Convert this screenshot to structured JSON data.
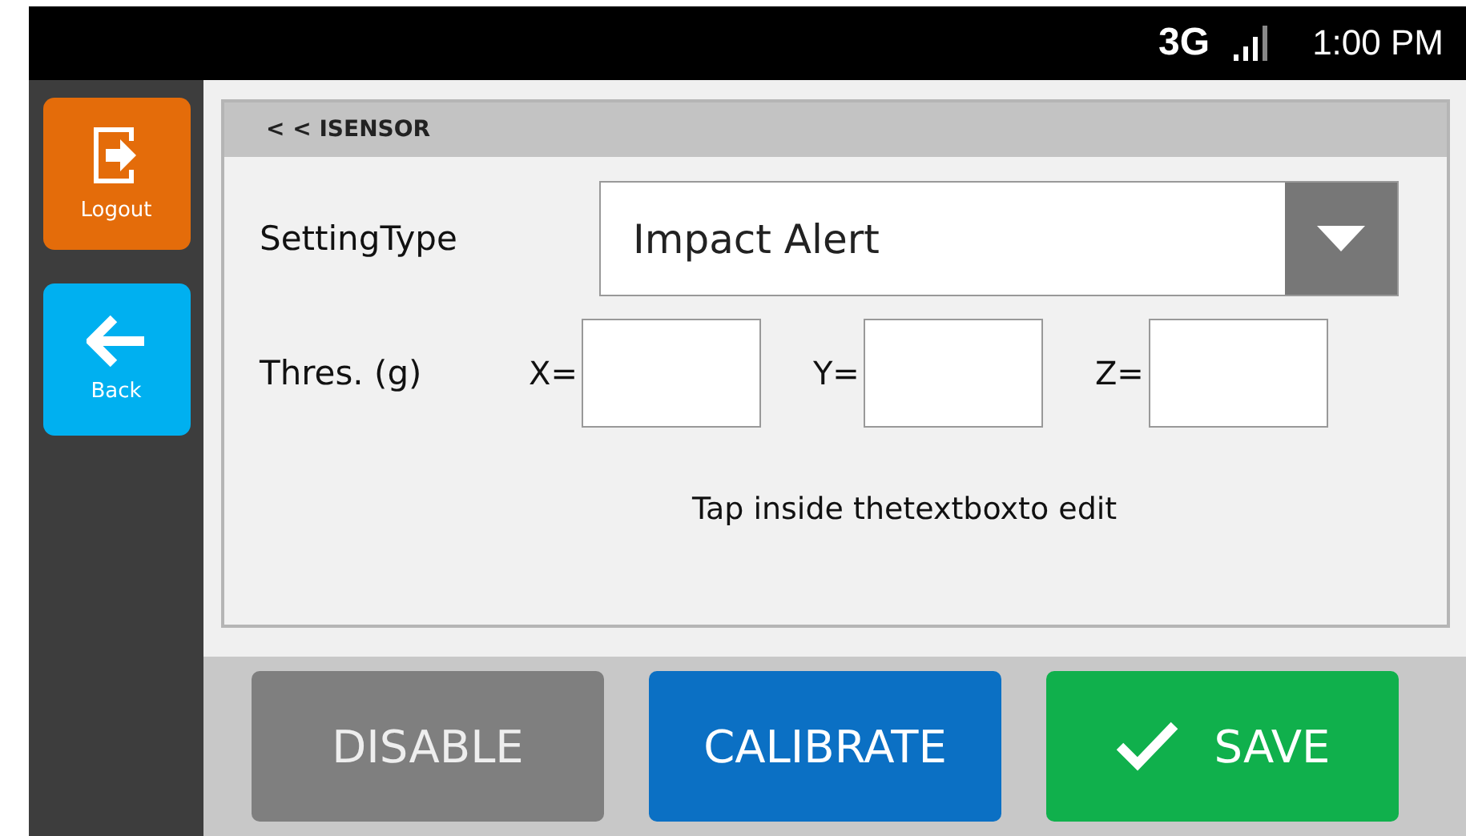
{
  "status_bar": {
    "network": "3G",
    "time": "1:00 PM"
  },
  "sidebar": [
    {
      "label": "Logout",
      "kind": "logout"
    },
    {
      "label": "Back",
      "kind": "back"
    }
  ],
  "panel": {
    "title": "< < ISENSOR",
    "setting_type": {
      "label": "SettingType",
      "value": "Impact Alert"
    },
    "threshold": {
      "label": "Thres.  (g)",
      "fields": [
        {
          "label": "X="
        },
        {
          "label": "Y="
        },
        {
          "label": "Z="
        }
      ]
    },
    "hint": "Tap inside thetextboxto edit"
  },
  "buttons": [
    {
      "label": "DISABLE",
      "kind": "disable"
    },
    {
      "label": "CALIBRATE",
      "kind": "calibrate"
    },
    {
      "label": "SAVE",
      "kind": "save"
    }
  ]
}
